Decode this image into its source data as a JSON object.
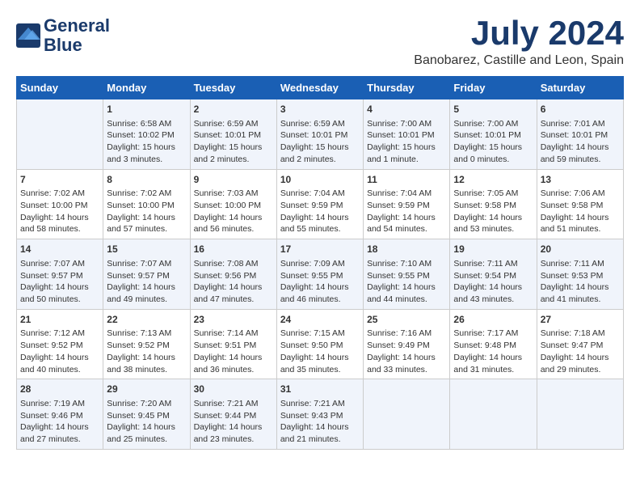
{
  "header": {
    "logo_line1": "General",
    "logo_line2": "Blue",
    "month_year": "July 2024",
    "location": "Banobarez, Castille and Leon, Spain"
  },
  "days_of_week": [
    "Sunday",
    "Monday",
    "Tuesday",
    "Wednesday",
    "Thursday",
    "Friday",
    "Saturday"
  ],
  "weeks": [
    [
      {
        "day": "",
        "content": ""
      },
      {
        "day": "1",
        "content": "Sunrise: 6:58 AM\nSunset: 10:02 PM\nDaylight: 15 hours\nand 3 minutes."
      },
      {
        "day": "2",
        "content": "Sunrise: 6:59 AM\nSunset: 10:01 PM\nDaylight: 15 hours\nand 2 minutes."
      },
      {
        "day": "3",
        "content": "Sunrise: 6:59 AM\nSunset: 10:01 PM\nDaylight: 15 hours\nand 2 minutes."
      },
      {
        "day": "4",
        "content": "Sunrise: 7:00 AM\nSunset: 10:01 PM\nDaylight: 15 hours\nand 1 minute."
      },
      {
        "day": "5",
        "content": "Sunrise: 7:00 AM\nSunset: 10:01 PM\nDaylight: 15 hours\nand 0 minutes."
      },
      {
        "day": "6",
        "content": "Sunrise: 7:01 AM\nSunset: 10:01 PM\nDaylight: 14 hours\nand 59 minutes."
      }
    ],
    [
      {
        "day": "7",
        "content": "Sunrise: 7:02 AM\nSunset: 10:00 PM\nDaylight: 14 hours\nand 58 minutes."
      },
      {
        "day": "8",
        "content": "Sunrise: 7:02 AM\nSunset: 10:00 PM\nDaylight: 14 hours\nand 57 minutes."
      },
      {
        "day": "9",
        "content": "Sunrise: 7:03 AM\nSunset: 10:00 PM\nDaylight: 14 hours\nand 56 minutes."
      },
      {
        "day": "10",
        "content": "Sunrise: 7:04 AM\nSunset: 9:59 PM\nDaylight: 14 hours\nand 55 minutes."
      },
      {
        "day": "11",
        "content": "Sunrise: 7:04 AM\nSunset: 9:59 PM\nDaylight: 14 hours\nand 54 minutes."
      },
      {
        "day": "12",
        "content": "Sunrise: 7:05 AM\nSunset: 9:58 PM\nDaylight: 14 hours\nand 53 minutes."
      },
      {
        "day": "13",
        "content": "Sunrise: 7:06 AM\nSunset: 9:58 PM\nDaylight: 14 hours\nand 51 minutes."
      }
    ],
    [
      {
        "day": "14",
        "content": "Sunrise: 7:07 AM\nSunset: 9:57 PM\nDaylight: 14 hours\nand 50 minutes."
      },
      {
        "day": "15",
        "content": "Sunrise: 7:07 AM\nSunset: 9:57 PM\nDaylight: 14 hours\nand 49 minutes."
      },
      {
        "day": "16",
        "content": "Sunrise: 7:08 AM\nSunset: 9:56 PM\nDaylight: 14 hours\nand 47 minutes."
      },
      {
        "day": "17",
        "content": "Sunrise: 7:09 AM\nSunset: 9:55 PM\nDaylight: 14 hours\nand 46 minutes."
      },
      {
        "day": "18",
        "content": "Sunrise: 7:10 AM\nSunset: 9:55 PM\nDaylight: 14 hours\nand 44 minutes."
      },
      {
        "day": "19",
        "content": "Sunrise: 7:11 AM\nSunset: 9:54 PM\nDaylight: 14 hours\nand 43 minutes."
      },
      {
        "day": "20",
        "content": "Sunrise: 7:11 AM\nSunset: 9:53 PM\nDaylight: 14 hours\nand 41 minutes."
      }
    ],
    [
      {
        "day": "21",
        "content": "Sunrise: 7:12 AM\nSunset: 9:52 PM\nDaylight: 14 hours\nand 40 minutes."
      },
      {
        "day": "22",
        "content": "Sunrise: 7:13 AM\nSunset: 9:52 PM\nDaylight: 14 hours\nand 38 minutes."
      },
      {
        "day": "23",
        "content": "Sunrise: 7:14 AM\nSunset: 9:51 PM\nDaylight: 14 hours\nand 36 minutes."
      },
      {
        "day": "24",
        "content": "Sunrise: 7:15 AM\nSunset: 9:50 PM\nDaylight: 14 hours\nand 35 minutes."
      },
      {
        "day": "25",
        "content": "Sunrise: 7:16 AM\nSunset: 9:49 PM\nDaylight: 14 hours\nand 33 minutes."
      },
      {
        "day": "26",
        "content": "Sunrise: 7:17 AM\nSunset: 9:48 PM\nDaylight: 14 hours\nand 31 minutes."
      },
      {
        "day": "27",
        "content": "Sunrise: 7:18 AM\nSunset: 9:47 PM\nDaylight: 14 hours\nand 29 minutes."
      }
    ],
    [
      {
        "day": "28",
        "content": "Sunrise: 7:19 AM\nSunset: 9:46 PM\nDaylight: 14 hours\nand 27 minutes."
      },
      {
        "day": "29",
        "content": "Sunrise: 7:20 AM\nSunset: 9:45 PM\nDaylight: 14 hours\nand 25 minutes."
      },
      {
        "day": "30",
        "content": "Sunrise: 7:21 AM\nSunset: 9:44 PM\nDaylight: 14 hours\nand 23 minutes."
      },
      {
        "day": "31",
        "content": "Sunrise: 7:21 AM\nSunset: 9:43 PM\nDaylight: 14 hours\nand 21 minutes."
      },
      {
        "day": "",
        "content": ""
      },
      {
        "day": "",
        "content": ""
      },
      {
        "day": "",
        "content": ""
      }
    ]
  ]
}
